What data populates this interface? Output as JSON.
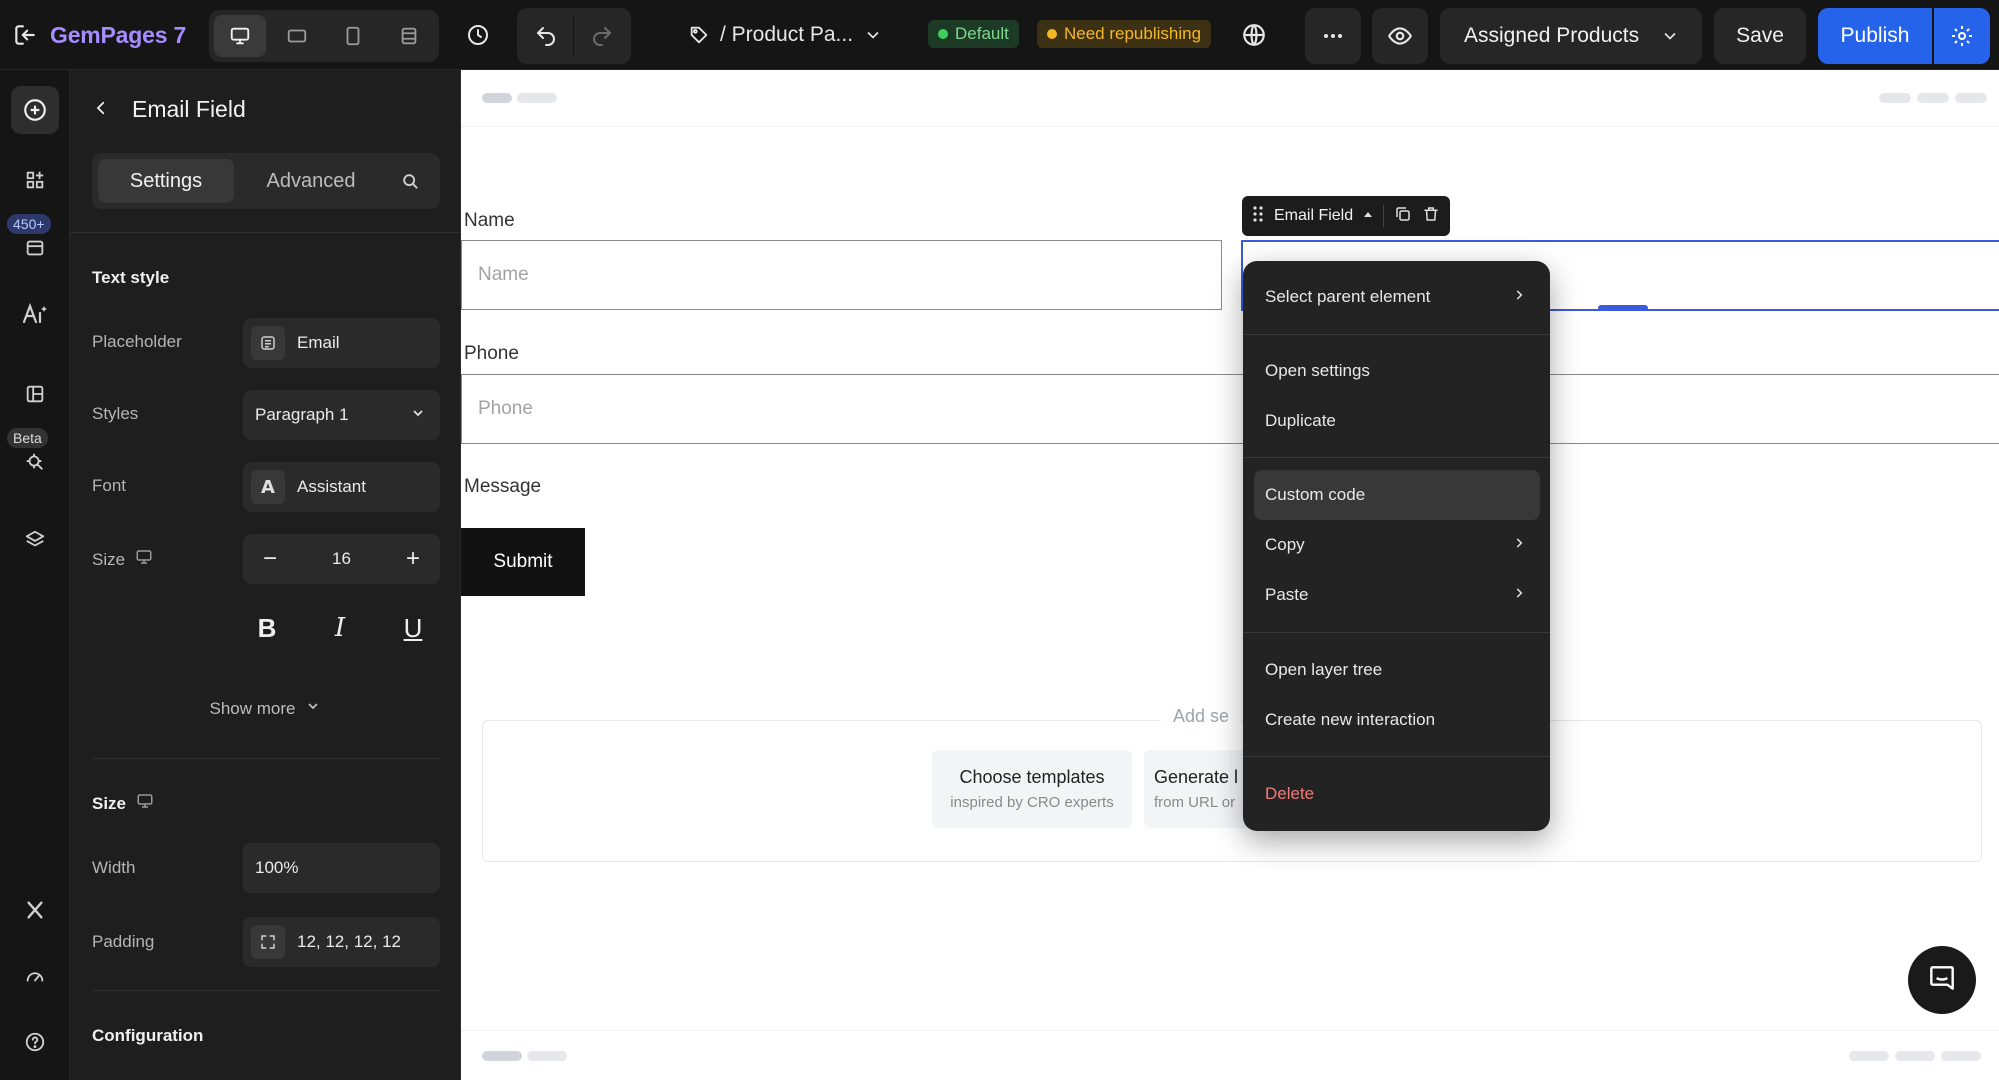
{
  "app": {
    "name": "GemPages 7"
  },
  "topbar": {
    "page_title": "/ Product Pa...",
    "badge_default": "Default",
    "badge_warning": "Need republishing",
    "assigned_label": "Assigned Products",
    "save_label": "Save",
    "publish_label": "Publish",
    "colors": {
      "publish": "#2563eb",
      "brand": "#a58cff",
      "default_dot": "#3ccf5c",
      "warning": "#f4b728"
    }
  },
  "rail": {
    "badge_count": "450+",
    "badge_beta": "Beta",
    "icons": [
      "add-element-icon",
      "apps-icon",
      "sections-icon",
      "ai-icon",
      "pages-icon",
      "beta-tool-icon",
      "layers-icon",
      "x-icon",
      "speed-icon",
      "help-icon"
    ]
  },
  "panel": {
    "title": "Email Field",
    "tabs": {
      "settings": "Settings",
      "advanced": "Advanced"
    },
    "text_style": {
      "heading": "Text style",
      "placeholder_label": "Placeholder",
      "placeholder_value": "Email",
      "styles_label": "Styles",
      "styles_value": "Paragraph 1",
      "font_label": "Font",
      "font_value": "Assistant",
      "font_icon_glyph": "A",
      "size_label": "Size",
      "size_value": "16",
      "minus": "−",
      "plus": "+",
      "bold": "B",
      "italic": "I",
      "underline": "U",
      "show_more": "Show more"
    },
    "size_section": {
      "heading": "Size",
      "width_label": "Width",
      "width_value": "100%",
      "padding_label": "Padding",
      "padding_value": "12, 12, 12, 12"
    },
    "configuration_heading": "Configuration"
  },
  "canvas": {
    "form": {
      "name_label": "Name",
      "name_placeholder": "Name",
      "phone_label": "Phone",
      "phone_placeholder": "Phone",
      "message_label": "Message",
      "submit_label": "Submit"
    },
    "selected_tag": "Email Field",
    "add_section": {
      "title": "Add se",
      "choose_templates": "Choose templates",
      "choose_templates_sub": "inspired by CRO experts",
      "generate": "Generate l",
      "generate_sub": "from URL or"
    }
  },
  "context_menu": {
    "items": [
      "Select parent element",
      "Open settings",
      "Duplicate",
      "Custom code",
      "Copy",
      "Paste",
      "Open layer tree",
      "Create new interaction",
      "Delete"
    ],
    "highlighted": "Custom code"
  }
}
